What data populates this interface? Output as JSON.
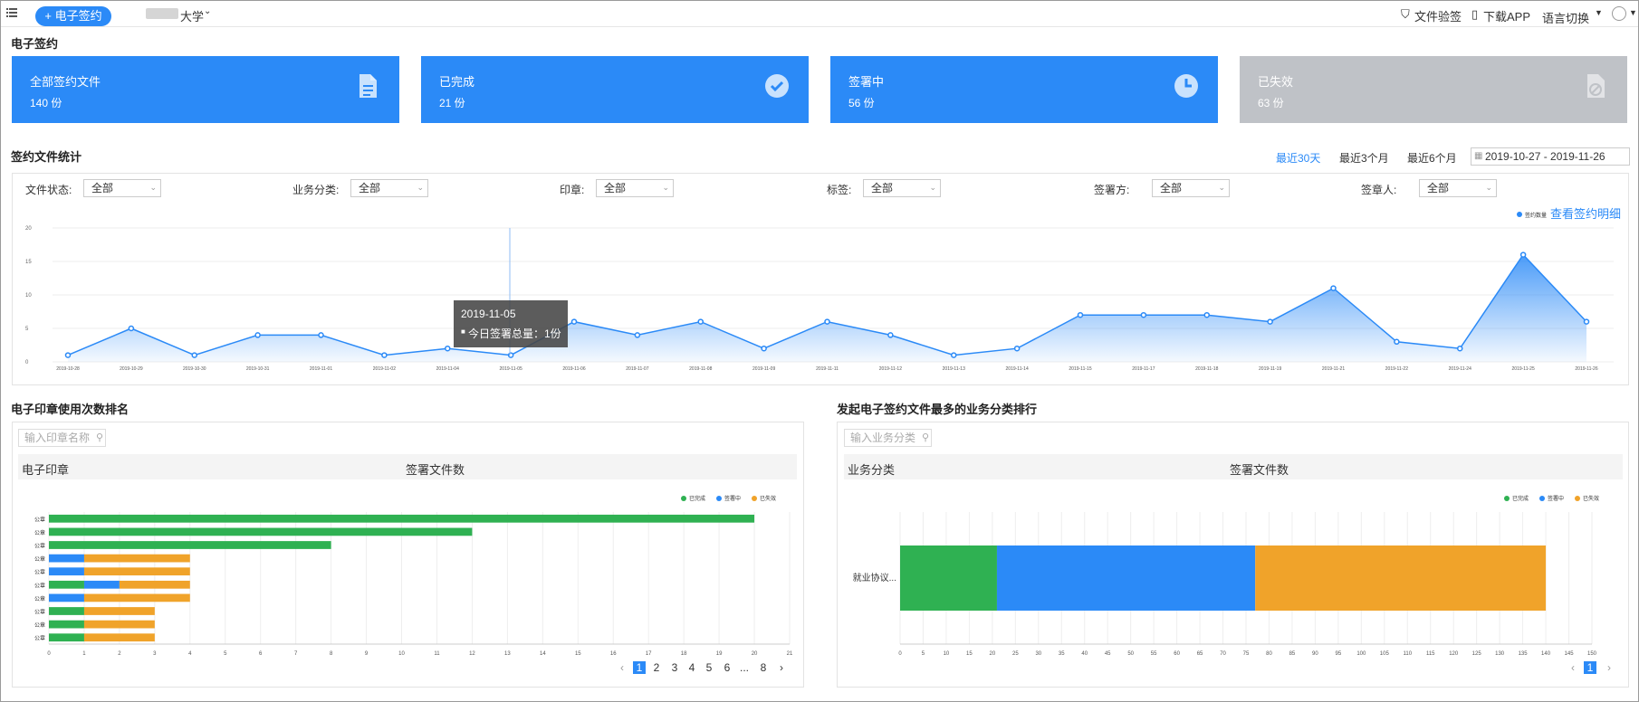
{
  "topbar": {
    "new_sign_label": "+ 电子签约",
    "org_name": "大学",
    "verify_label": "文件验签",
    "download_label": "下载APP",
    "language_label": "语言切换"
  },
  "page_title": "电子签约",
  "cards": [
    {
      "label": "全部签约文件",
      "count": "140 份",
      "icon": "document-icon"
    },
    {
      "label": "已完成",
      "count": "21 份",
      "icon": "check-circle-icon"
    },
    {
      "label": "签署中",
      "count": "56 份",
      "icon": "clock-icon"
    },
    {
      "label": "已失效",
      "count": "63 份",
      "icon": "invalid-document-icon"
    }
  ],
  "stats_title": "签约文件统计",
  "ranges": [
    "最近30天",
    "最近3个月",
    "最近6个月"
  ],
  "active_range": "最近30天",
  "date_range": "2019-10-27 - 2019-11-26",
  "filters": [
    {
      "label": "文件状态:",
      "value": "全部"
    },
    {
      "label": "业务分类:",
      "value": "全部"
    },
    {
      "label": "印章:",
      "value": "全部"
    },
    {
      "label": "标签:",
      "value": "全部"
    },
    {
      "label": "签署方:",
      "value": "全部"
    },
    {
      "label": "签章人:",
      "value": "全部"
    }
  ],
  "detail_link": "查看签约明细",
  "tooltip": {
    "date": "2019-11-05",
    "text": "今日签署总量：1份"
  },
  "seal_rank": {
    "title": "电子印章使用次数排名",
    "search_placeholder": "输入印章名称",
    "col1": "电子印章",
    "col2": "签署文件数",
    "pages": [
      "1",
      "2",
      "3",
      "4",
      "5",
      "6",
      "...",
      "8"
    ]
  },
  "biz_rank": {
    "title": "发起电子签约文件最多的业务分类排行",
    "search_placeholder": "输入业务分类",
    "col1": "业务分类",
    "col2": "签署文件数",
    "pages": [
      "1"
    ]
  },
  "chart_data": [
    {
      "type": "area",
      "series": [
        {
          "name": "签约数量",
          "color": "#2b8af7",
          "values": [
            1,
            5,
            1,
            4,
            4,
            1,
            2,
            1,
            6,
            4,
            6,
            2,
            6,
            4,
            1,
            2,
            7,
            7,
            7,
            6,
            11,
            3,
            2,
            16,
            6
          ]
        }
      ],
      "x": [
        "2019-10-28",
        "2019-10-29",
        "2019-10-30",
        "2019-10-31",
        "2019-11-01",
        "2019-11-02",
        "2019-11-04",
        "2019-11-05",
        "2019-11-06",
        "2019-11-07",
        "2019-11-08",
        "2019-11-09",
        "2019-11-11",
        "2019-11-12",
        "2019-11-13",
        "2019-11-14",
        "2019-11-15",
        "2019-11-17",
        "2019-11-18",
        "2019-11-19",
        "2019-11-21",
        "2019-11-22",
        "2019-11-24",
        "2019-11-25",
        "2019-11-26"
      ],
      "yticks": [
        "0",
        "5",
        "10",
        "15",
        "20"
      ],
      "ylim": [
        0,
        20
      ],
      "grid": true,
      "legend": "top-right"
    },
    {
      "type": "bar",
      "orientation": "horizontal",
      "stacked": true,
      "categories": [
        "公章",
        "公章",
        "公章",
        "公章",
        "公章",
        "公章",
        "公章",
        "公章",
        "公章",
        "公章"
      ],
      "series": [
        {
          "name": "已完成",
          "color": "#2fb152",
          "values": [
            20,
            12,
            8,
            0,
            0,
            1,
            0,
            1,
            1,
            1
          ]
        },
        {
          "name": "签署中",
          "color": "#2b8af7",
          "values": [
            0,
            0,
            0,
            1,
            1,
            1,
            1,
            0,
            0,
            0
          ]
        },
        {
          "name": "已失效",
          "color": "#f0a32a",
          "values": [
            0,
            0,
            0,
            3,
            3,
            2,
            3,
            2,
            2,
            2
          ]
        }
      ],
      "xticks": [
        "0",
        "1",
        "2",
        "3",
        "4",
        "5",
        "6",
        "7",
        "8",
        "9",
        "10",
        "11",
        "12",
        "13",
        "14",
        "15",
        "16",
        "17",
        "18",
        "19",
        "20",
        "21"
      ],
      "xlim": [
        0,
        21
      ],
      "grid": true,
      "legend": "top-right"
    },
    {
      "type": "bar",
      "orientation": "horizontal",
      "stacked": true,
      "categories": [
        "就业协议..."
      ],
      "series": [
        {
          "name": "已完成",
          "color": "#2fb152",
          "values": [
            21
          ]
        },
        {
          "name": "签署中",
          "color": "#2b8af7",
          "values": [
            56
          ]
        },
        {
          "name": "已失效",
          "color": "#f0a32a",
          "values": [
            63
          ]
        }
      ],
      "xticks": [
        "0",
        "5",
        "10",
        "15",
        "20",
        "25",
        "30",
        "35",
        "40",
        "45",
        "50",
        "55",
        "60",
        "65",
        "70",
        "75",
        "80",
        "85",
        "90",
        "95",
        "100",
        "105",
        "110",
        "115",
        "120",
        "125",
        "130",
        "135",
        "140",
        "145",
        "150"
      ],
      "xlim": [
        0,
        150
      ],
      "grid": true,
      "legend": "top-right"
    }
  ]
}
